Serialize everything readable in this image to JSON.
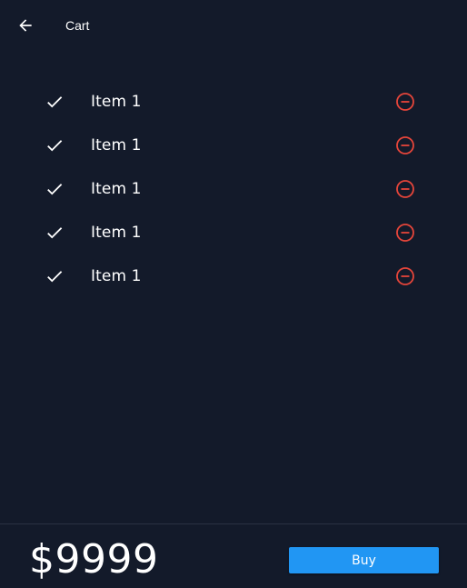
{
  "app_bar": {
    "title": "Cart",
    "back_icon": "arrow-left-icon"
  },
  "cart": {
    "items": [
      {
        "label": "Item 1",
        "checked": true
      },
      {
        "label": "Item 1",
        "checked": true
      },
      {
        "label": "Item 1",
        "checked": true
      },
      {
        "label": "Item 1",
        "checked": true
      },
      {
        "label": "Item 1",
        "checked": true
      }
    ],
    "item_icon": "check-icon",
    "remove_icon": "remove-circle-outline-icon"
  },
  "footer": {
    "total": "$9999",
    "buy_label": "Buy"
  },
  "colors": {
    "background": "#131a2a",
    "text": "#ffffff",
    "remove_red": "#e5453a",
    "button_blue": "#2196f3"
  }
}
